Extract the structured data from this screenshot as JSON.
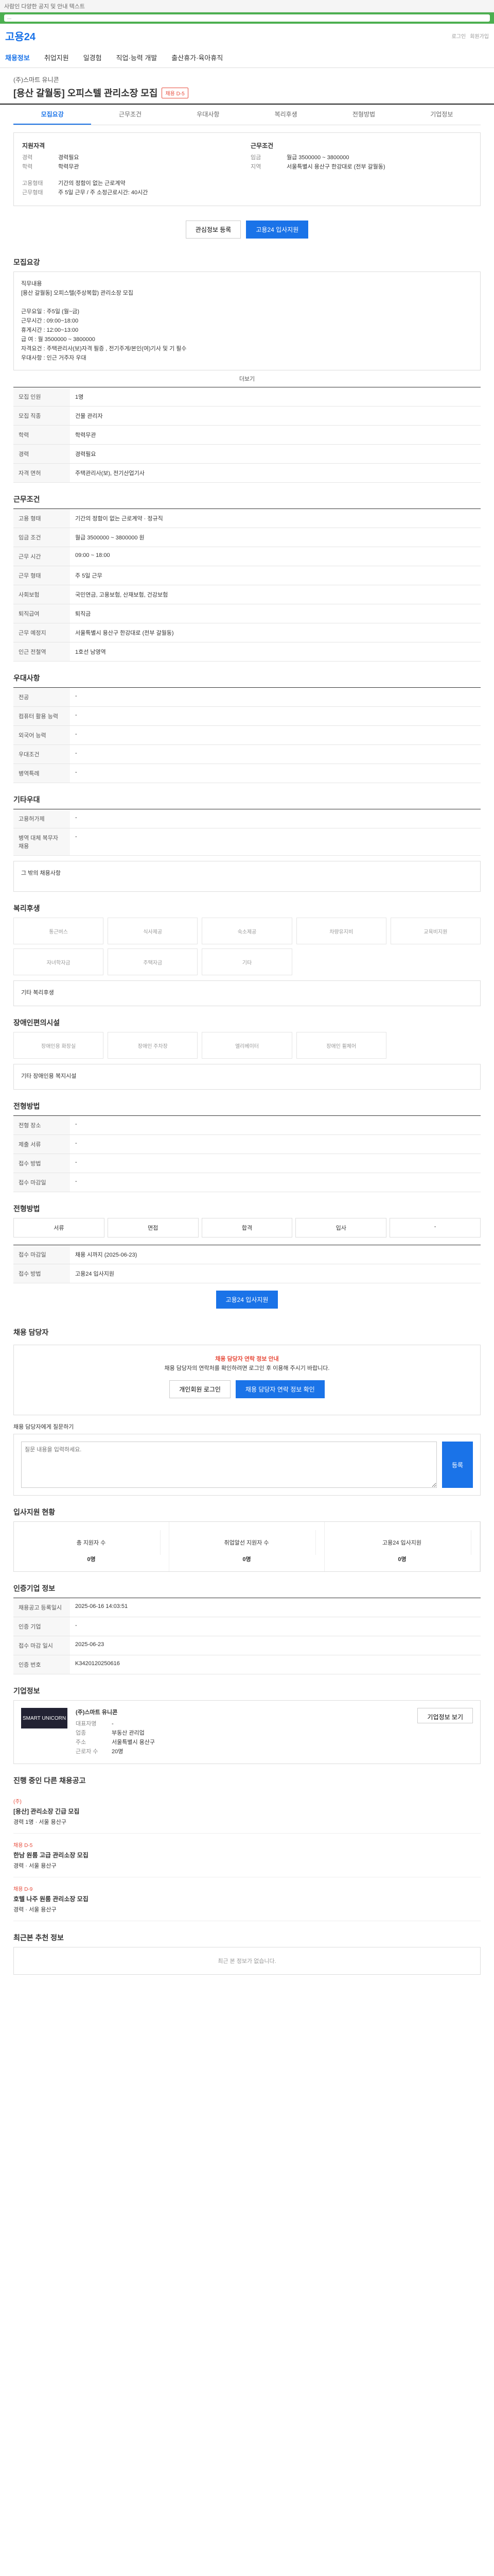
{
  "browser": {
    "notice": "사람인 다양한 공지 및 안내 텍스트",
    "url": "..."
  },
  "brand": {
    "logo": "고용24",
    "util": [
      "로그인",
      "회원가입"
    ]
  },
  "gnb": [
    "채용정보",
    "취업지원",
    "일경험",
    "직업·능력 개발",
    "출산휴가·육아휴직"
  ],
  "job": {
    "org": "(주)스마트 유니콘",
    "title": "[용산 갈월동] 오피스텔 관리소장 모집",
    "tag": "채용 D-5"
  },
  "tabs": [
    "모집요강",
    "근무조건",
    "우대사항",
    "복리후생",
    "전형방법",
    "기업정보"
  ],
  "summary": {
    "left_title": "지원자격",
    "left": [
      [
        "경력",
        "경력필요"
      ],
      [
        "학력",
        "학력무관"
      ]
    ],
    "right_title": "근무조건",
    "right": [
      [
        "임금",
        "월급 3500000 ~ 3800000"
      ],
      [
        "지역",
        "서울특별시 용산구 한강대로 (전부 갈월동)"
      ]
    ],
    "extra": [
      [
        "고용형태",
        "기간의 정함이 없는 근로계약"
      ],
      [
        "근무형태",
        "주 5일 근무 / 주 소정근로시간: 40시간"
      ]
    ]
  },
  "buttons": {
    "scrap": "관심정보 등록",
    "apply": "고용24 입사지원"
  },
  "sections": {
    "recruit": "모집요강",
    "conditions": "근무조건",
    "prefer": "우대사항",
    "other": "기타우대",
    "welfare": "복리후생",
    "disabled": "장애인편의시설",
    "process": "전형방법",
    "flow": "전형방법",
    "contact": "채용 담당자",
    "status": "입사지원 현황",
    "info": "인증기업 정보",
    "company": "기업정보",
    "related": "진행 중인 다른 채용공고",
    "recent": "최근본 추천 정보"
  },
  "recruit_text": "직무내용\n[용산 갈월동] 오피스텔(주상복합) 관리소장 모집\n\n근무요일 : 주5일 (월~금)\n근무시간 : 09:00~18:00\n휴게시간 : 12:00~13:00\n급  여 : 월 3500000 ~ 3800000\n자격요건 : 주택관리사(보)자격 필증 , 전기주게/본인(여)기사 및 기 필수\n우대사항 : 인근 거주자 우대",
  "more_label": "더보기",
  "recruit_rows": [
    [
      "모집 인원",
      "1명"
    ],
    [
      "모집 직종",
      "건물 관리자"
    ],
    [
      "학력",
      "학력무관"
    ],
    [
      "경력",
      "경력필요"
    ],
    [
      "자격 면허",
      "주택관리사(보), 전기산업기사"
    ]
  ],
  "cond_rows": [
    [
      "고용 형태",
      "기간의 정함이 없는 근로계약 · 정규직"
    ],
    [
      "임금 조건",
      "월급 3500000 ~ 3800000 원"
    ],
    [
      "근무 시간",
      "09:00 ~ 18:00"
    ],
    [
      "근무 형태",
      "주 5일 근무"
    ],
    [
      "사회보험",
      "국민연금, 고용보험, 산재보험, 건강보험"
    ],
    [
      "퇴직급여",
      "퇴직금"
    ],
    [
      "근무 예정지",
      "서울특별시 용산구 한강대로 (전부 갈월동)"
    ],
    [
      "인근 전철역",
      "1호선 남영역"
    ]
  ],
  "prefer_rows": [
    [
      "전공",
      "-"
    ],
    [
      "컴퓨터 활용 능력",
      "-"
    ],
    [
      "외국어 능력",
      "-"
    ],
    [
      "우대조건",
      "-"
    ],
    [
      "병역특례",
      "-"
    ]
  ],
  "other_rows": [
    [
      "고용허가제",
      "-"
    ],
    [
      "병역 대체 복무자 채용",
      "-"
    ]
  ],
  "other_note": "그 밖의 채용사항",
  "welfare_icons": [
    "통근버스",
    "식사제공",
    "숙소제공",
    "차량유지비",
    "교육비지원",
    "자녀학자금",
    "주택자금",
    "기타"
  ],
  "welfare_note": "기타 복리후생",
  "disabled_icons": [
    "장애인용 화장실",
    "장애인 주차장",
    "엘리베이터",
    "장애인 휠체어"
  ],
  "disabled_note": "기타 장애인용 복지시설",
  "process_rows": [
    [
      "전형 장소",
      "-"
    ],
    [
      "제출 서류",
      "-"
    ],
    [
      "접수 방법",
      "-"
    ],
    [
      "접수 마감일",
      "-"
    ]
  ],
  "flow_steps": [
    "서류",
    "면접",
    "합격",
    "입사",
    "-"
  ],
  "contact_rows": [
    [
      "접수 마감일",
      "채용 시까지 (2025-06-23)"
    ],
    [
      "접수 방법",
      "고용24 입사지원"
    ]
  ],
  "notice": {
    "title": "채용 담당자 연락 정보 안내",
    "body": "채용 담당자의 연락처를 확인하려면 로그인 후 이용해 주시기 바랍니다.",
    "btn1": "개인회원 로그인",
    "btn2": "채용 담당자 연락 정보 확인"
  },
  "qa": {
    "label": "채용 담당자에게 질문하기",
    "placeholder": "질문 내용을 입력하세요.",
    "submit": "등록"
  },
  "status_cards": [
    [
      "총 지원자 수",
      "0명"
    ],
    [
      "취업알선 지원자 수",
      "0명"
    ],
    [
      "고용24 입사지원",
      "0명"
    ]
  ],
  "info_rows": [
    [
      "채용공고 등록일시",
      "2025-06-16 14:03:51"
    ],
    [
      "인증 기업",
      "-"
    ],
    [
      "접수 마감 일시",
      "2025-06-23"
    ],
    [
      "인증 번호",
      "K3420120250616"
    ]
  ],
  "company": {
    "logo": "SMART UNICORN",
    "name": "(주)스마트 유니콘",
    "rows": [
      [
        "대표자명",
        "-"
      ],
      [
        "업종",
        "부동산 관리업"
      ],
      [
        "주소",
        "서울특별시 용산구"
      ],
      [
        "근로자 수",
        "20명"
      ]
    ],
    "more": "기업정보 보기"
  },
  "related": [
    {
      "org": "(주)",
      "title": "[용산] 관리소장 긴급 모집",
      "meta": "경력 1명 · 서울 용산구"
    },
    {
      "org": "채용 D-5",
      "title": "한남 원룸 고급 관리소장 모집",
      "meta": "경력 · 서울 용산구"
    },
    {
      "org": "채용 D-9",
      "title": "호텔 나주 원룸 관리소장 모집",
      "meta": "경력 · 서울 용산구"
    }
  ],
  "recent_empty": "최근 본 정보가 없습니다."
}
